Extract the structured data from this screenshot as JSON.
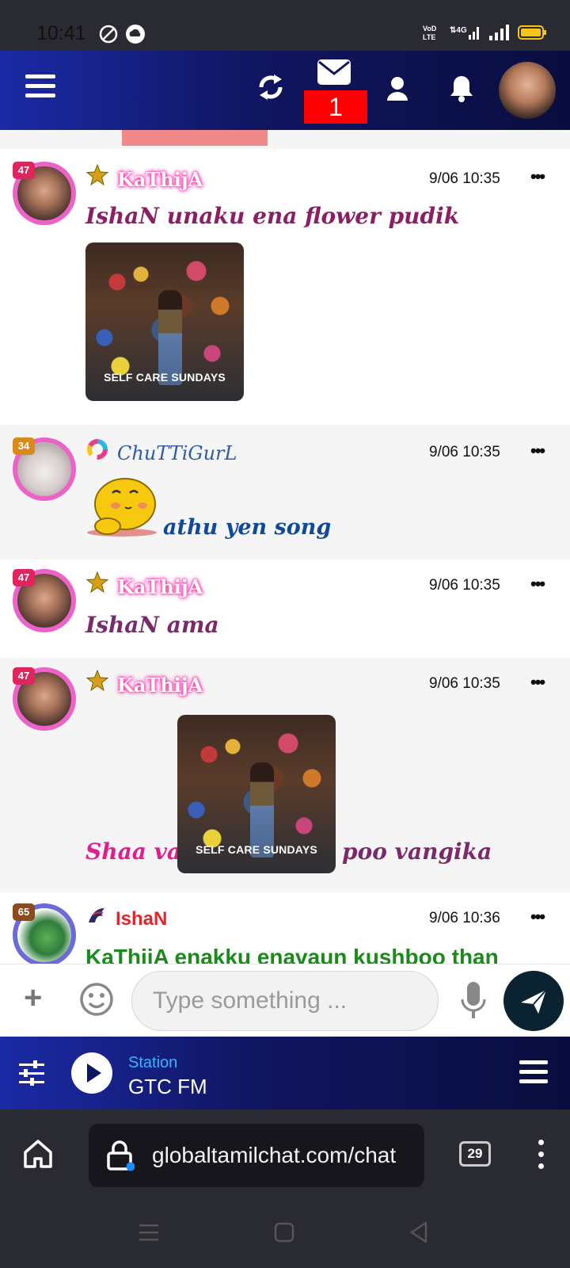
{
  "status_bar": {
    "time": "10:41",
    "icons": [
      "vpn-icon",
      "cloud-icon",
      "volte-icon",
      "4g-signal-icon",
      "signal-icon",
      "battery-icon"
    ]
  },
  "header": {
    "menu_icon": "hamburger-icon",
    "refresh_icon": "refresh-icon",
    "mail_icon": "envelope-icon",
    "mail_count": "1",
    "profile_icon": "user-icon",
    "bell_icon": "bell-icon",
    "avatar_icon": "avatar"
  },
  "messages": [
    {
      "level": "47",
      "username": "KaThijA",
      "time": "9/06 10:35",
      "text": "IshaN unaku ena flower pudik",
      "image_caption": "SELF CARE SUNDAYS"
    },
    {
      "level": "34",
      "username": "ChuTTiGurL",
      "time": "9/06 10:35",
      "text": "athu yen song"
    },
    {
      "level": "47",
      "username": "KaThijA",
      "time": "9/06 10:35",
      "text": "IshaN ama"
    },
    {
      "level": "47",
      "username": "KaThijA",
      "time": "9/06 10:35",
      "text_before": "Shaa va",
      "image_caption": "SELF CARE SUNDAYS",
      "text_after": "poo vangika"
    },
    {
      "level": "65",
      "username": "IshaN",
      "time": "9/06 10:36",
      "text": "KaThijA enakku enavaun kushboo than"
    }
  ],
  "more_label": "•••",
  "composer": {
    "plus_label": "+",
    "placeholder": "Type something ..."
  },
  "radio": {
    "label": "Station",
    "name": "GTC FM"
  },
  "browser": {
    "url": "globaltamilchat.com/chat",
    "tab_count": "29"
  },
  "colors": {
    "header_start": "#1b2aa6",
    "header_end": "#0a0e3e",
    "badge": "#ff0000",
    "kathija_glow": "#ff2fa8",
    "ring": "#ec63c8"
  }
}
